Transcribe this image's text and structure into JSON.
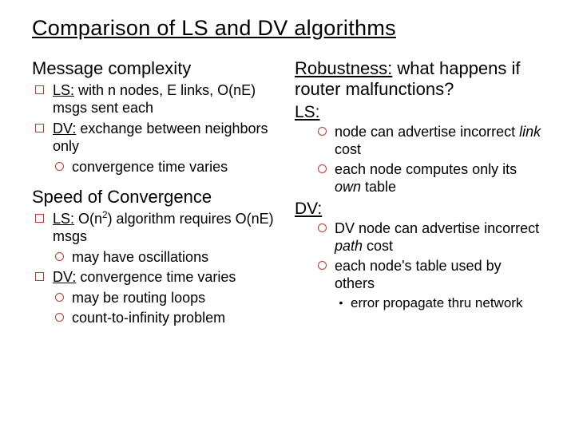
{
  "title": "Comparison of LS and DV algorithms",
  "left": {
    "h1": "Message complexity",
    "mc": {
      "ls_prefix": "LS:",
      "ls_rest": " with n nodes, E links, O(nE) msgs sent each",
      "dv_prefix": "DV:",
      "dv_rest": " exchange between neighbors only",
      "dv_sub1": "convergence time varies"
    },
    "h2": "Speed of Convergence",
    "sc": {
      "ls_prefix": "LS:",
      "ls_mid": " O(n",
      "ls_sup": "2",
      "ls_after": ") algorithm requires O(nE) msgs",
      "ls_sub1": "may have oscillations",
      "dv_prefix": "DV:",
      "dv_rest": " convergence time varies",
      "dv_sub1": "may be routing loops",
      "dv_sub2": "count-to-infinity problem"
    }
  },
  "right": {
    "h1a": "Robustness:",
    "h1b": " what happens if router malfunctions?",
    "ls_label": "LS:",
    "ls": {
      "s1a": "node can advertise incorrect ",
      "s1b": "link",
      "s1c": " cost",
      "s2a": "each node computes only its ",
      "s2b": "own",
      "s2c": " table"
    },
    "dv_label": "DV:",
    "dv": {
      "s1a": "DV node can advertise incorrect ",
      "s1b": "path",
      "s1c": " cost",
      "s2": "each node's table used by others",
      "s3": "error propagate thru network"
    }
  }
}
